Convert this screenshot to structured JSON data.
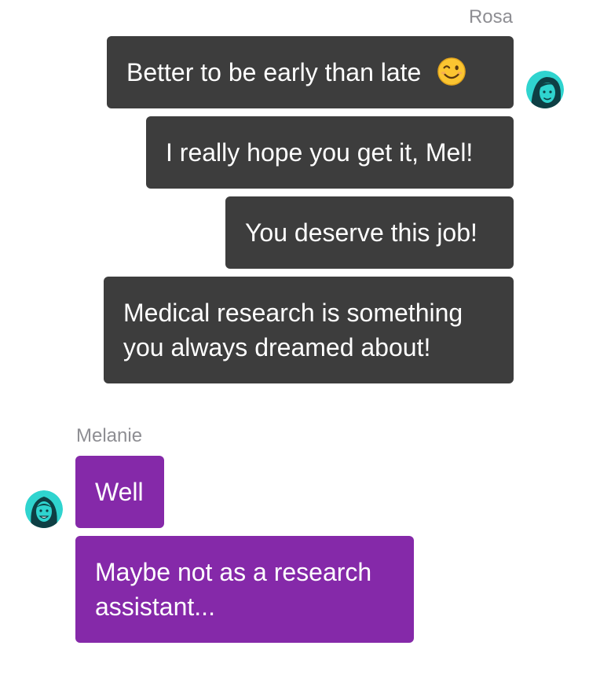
{
  "conversation": {
    "rosa": {
      "name": "Rosa",
      "avatar_icon": "rosa-avatar-icon",
      "messages": [
        {
          "text": "Better to be early than late",
          "emoji": "winking-face-icon"
        },
        {
          "text": "I really hope you get it, Mel!"
        },
        {
          "text": "You deserve this job!"
        },
        {
          "text": "Medical research is something you always dreamed about!"
        }
      ]
    },
    "melanie": {
      "name": "Melanie",
      "avatar_icon": "melanie-avatar-icon",
      "messages": [
        {
          "text": "Well"
        },
        {
          "text": "Maybe not as a research assistant..."
        }
      ]
    }
  },
  "colors": {
    "outgoing_bubble": "#3d3d3d",
    "incoming_bubble": "#8529a9",
    "sender_label": "#8e8e93",
    "avatar_teal": "#2fd4cf",
    "avatar_dark": "#0e3f44"
  }
}
